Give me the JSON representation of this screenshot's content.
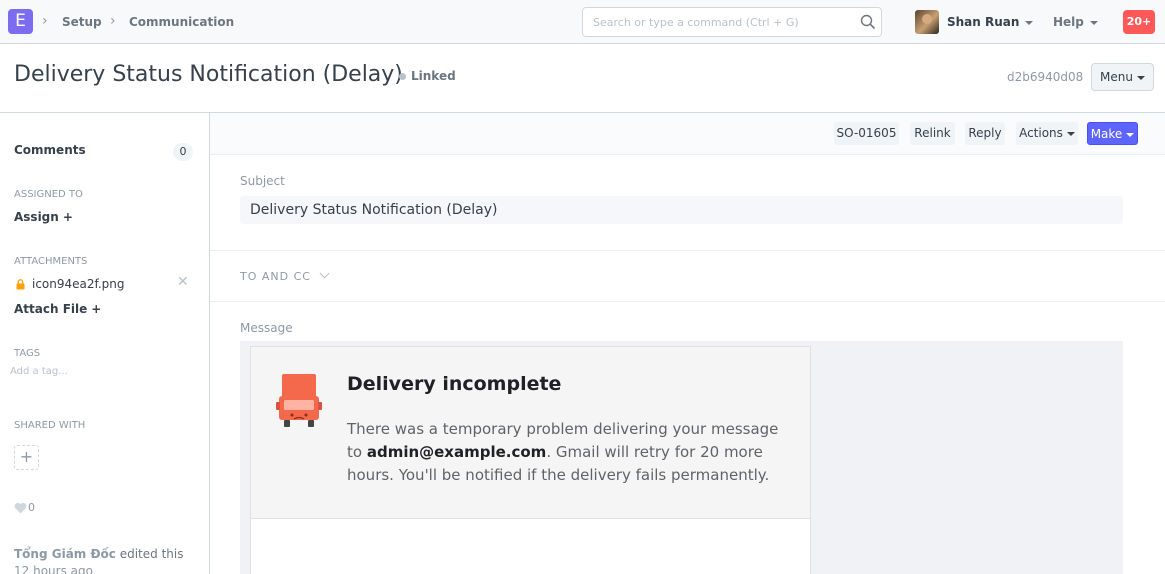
{
  "navbar": {
    "logo_letter": "E",
    "breadcrumbs": [
      "Setup",
      "Communication"
    ],
    "search_placeholder": "Search or type a command (Ctrl + G)",
    "user_name": "Shan Ruan",
    "help_label": "Help",
    "notifications": "20+"
  },
  "page": {
    "title": "Delivery Status Notification (Delay)",
    "status": "Linked",
    "doc_name": "d2b6940d08",
    "menu_label": "Menu"
  },
  "sidebar": {
    "comments_label": "Comments",
    "comments_count": "0",
    "assigned_label": "ASSIGNED TO",
    "assign_label": "Assign",
    "attachments_label": "ATTACHMENTS",
    "attachment_file": "icon94ea2f.png",
    "attach_file_label": "Attach File",
    "tags_label": "TAGS",
    "tag_placeholder": "Add a tag...",
    "shared_label": "SHARED WITH",
    "likes": "0",
    "timeline_user": "Tổng Giám Đốc",
    "timeline_action": " edited this",
    "timeline_time": "12 hours ago"
  },
  "toolbar": {
    "reference": "SO-01605",
    "relink": "Relink",
    "reply": "Reply",
    "actions": "Actions",
    "make": "Make"
  },
  "form": {
    "subject_label": "Subject",
    "subject_value": "Delivery Status Notification (Delay)",
    "to_cc_label": "TO AND CC",
    "message_label": "Message"
  },
  "email": {
    "title": "Delivery incomplete",
    "body_before": "There was a temporary problem delivering your message to ",
    "body_email": "admin@example.com",
    "body_after": ". Gmail will retry for 20 more hours. You'll be notified if the delivery fails permanently."
  },
  "colors": {
    "primary": "#5e64ff",
    "badge": "#ff5858",
    "logo": "#7c6cf0",
    "truck": "#f4694c"
  }
}
